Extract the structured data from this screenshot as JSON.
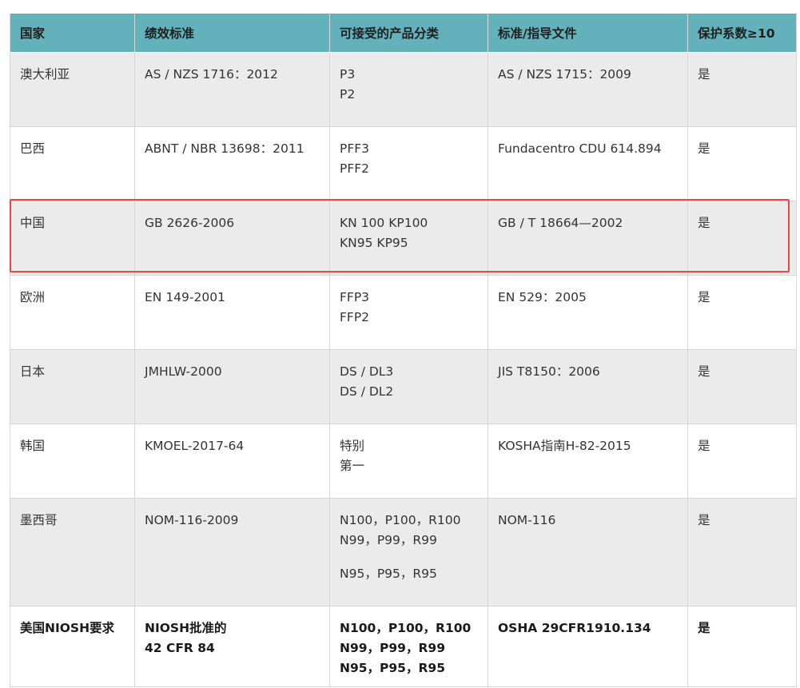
{
  "table": {
    "headers": [
      "国家",
      "绩效标准",
      "可接受的产品分类",
      "标准/指导文件",
      "保护系数≥10"
    ],
    "rows": [
      {
        "country": "澳大利亚",
        "standard": [
          "AS / NZS 1716：2012"
        ],
        "classes": [
          "P3",
          "P2"
        ],
        "guidance": [
          "AS / NZS 1715：2009"
        ],
        "factor": "是"
      },
      {
        "country": "巴西",
        "standard": [
          "ABNT / NBR 13698：2011"
        ],
        "classes": [
          "PFF3",
          "PFF2"
        ],
        "guidance": [
          "Fundacentro CDU 614.894"
        ],
        "factor": "是"
      },
      {
        "country": "中国",
        "standard": [
          "GB 2626-2006"
        ],
        "classes": [
          "KN 100 KP100",
          "KN95 KP95"
        ],
        "guidance": [
          "GB / T 18664—2002"
        ],
        "factor": "是"
      },
      {
        "country": "欧洲",
        "standard": [
          "EN 149-2001"
        ],
        "classes": [
          "FFP3",
          "FFP2"
        ],
        "guidance": [
          "EN 529：2005"
        ],
        "factor": "是"
      },
      {
        "country": "日本",
        "standard": [
          "JMHLW-2000"
        ],
        "classes": [
          "DS / DL3",
          "DS / DL2"
        ],
        "guidance": [
          "JIS T8150：2006"
        ],
        "factor": "是"
      },
      {
        "country": "韩国",
        "standard": [
          "KMOEL-2017-64"
        ],
        "classes": [
          "特别",
          "第一"
        ],
        "guidance": [
          "KOSHA指南H-82-2015"
        ],
        "factor": "是"
      },
      {
        "country": "墨西哥",
        "standard": [
          "NOM-116-2009"
        ],
        "classes": [
          "N100，P100，R100",
          "N99，P99，R99",
          "N95，P95，R95"
        ],
        "guidance": [
          "NOM-116"
        ],
        "factor": "是"
      },
      {
        "country": "美国NIOSH要求",
        "standard": [
          "NIOSH批准的",
          "42 CFR 84"
        ],
        "classes": [
          "N100，P100，R100",
          "N99，P99，R99",
          "N95，P95，R95"
        ],
        "guidance": [
          "OSHA 29CFR1910.134"
        ],
        "factor": "是"
      }
    ]
  },
  "highlight": {
    "row": "中国",
    "border_color": "#e8484a"
  },
  "colors": {
    "header_bg": "#63b2bb",
    "row_grey": "#ebebeb",
    "row_white": "#ffffff"
  }
}
